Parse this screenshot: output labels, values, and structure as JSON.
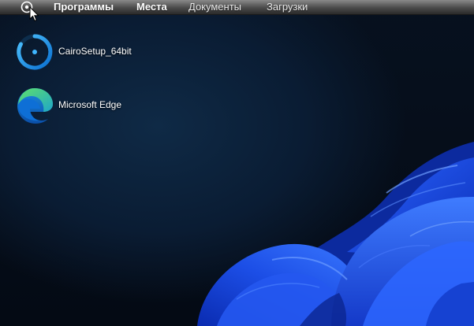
{
  "menubar": {
    "logo_icon": "cairo-logo-icon",
    "items": [
      {
        "label": "Программы"
      },
      {
        "label": "Места"
      },
      {
        "label": "Документы"
      },
      {
        "label": "Загрузки"
      }
    ]
  },
  "desktop": {
    "icons": [
      {
        "label": "CairoSetup_64bit",
        "icon": "cairo-setup-icon"
      },
      {
        "label": "Microsoft Edge",
        "icon": "edge-icon"
      }
    ]
  },
  "colors": {
    "background": "#050b16",
    "wallpaper_blue": "#1a4be0",
    "menubar_top": "#8a8a8a",
    "menubar_bottom": "#2a2a2a",
    "text": "#ffffff"
  }
}
